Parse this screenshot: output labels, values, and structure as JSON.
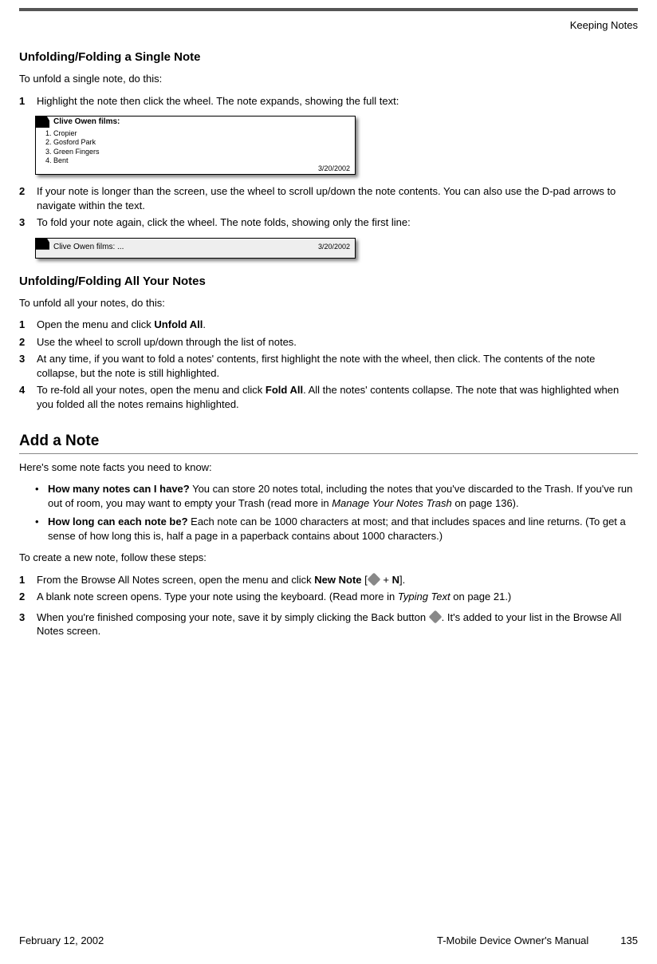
{
  "running_header": "Keeping Notes",
  "section1": {
    "heading": "Unfolding/Folding a Single Note",
    "intro": "To unfold a single note, do this:",
    "steps": [
      {
        "n": "1",
        "text": "Highlight the note then click the wheel. The note expands, showing the full text:"
      },
      {
        "n": "2",
        "text": "If your note is longer than the screen, use the wheel to scroll up/down the note contents. You can also use the D-pad arrows to navigate within the text."
      },
      {
        "n": "3",
        "text": "To fold your note again, click the wheel. The note folds, showing only the first line:"
      }
    ],
    "expanded_note": {
      "title": "Clive Owen films:",
      "lines": "1. Cropier\n2. Gosford Park\n3. Green Fingers\n4. Bent",
      "date": "3/20/2002"
    },
    "collapsed_note": {
      "title": "Clive Owen films: ...",
      "date": "3/20/2002"
    }
  },
  "section2": {
    "heading": "Unfolding/Folding All Your Notes",
    "intro": "To unfold all your notes, do this:",
    "steps": [
      {
        "n": "1",
        "pre": "Open the menu and click ",
        "bold": "Unfold All",
        "post": "."
      },
      {
        "n": "2",
        "text": "Use the wheel to scroll up/down through the list of notes."
      },
      {
        "n": "3",
        "text": "At any time, if you want to fold a notes' contents, first highlight the note with the wheel, then click. The contents of the note collapse, but the note is still highlighted."
      },
      {
        "n": "4",
        "pre": "To re-fold all your notes, open the menu and click ",
        "bold": "Fold All",
        "post": ". All the notes' contents collapse. The note that was highlighted when you folded all the notes remains highlighted."
      }
    ]
  },
  "section3": {
    "heading": "Add a Note",
    "intro": "Here's some note facts you need to know:",
    "bullets": [
      {
        "bold": "How many notes can I have?",
        "rest_a": " You can store 20 notes total, including the notes that you've discarded to the Trash. If you've run out of room, you may want to empty your Trash (read more in ",
        "ital": "Manage Your Notes Trash",
        "rest_b": " on page 136)."
      },
      {
        "bold": "How long can each note be?",
        "rest_a": " Each note can be 1000 characters at most; and that includes spaces and line returns. (To get a sense of how long this is, half a page in a paperback contains about 1000 characters.)",
        "ital": "",
        "rest_b": ""
      }
    ],
    "intro2": "To create a new note, follow these steps:",
    "steps": [
      {
        "n": "1",
        "pre": "From the Browse All Notes screen, open the menu and click ",
        "bold": "New Note",
        "mid": " [",
        "plus": " + ",
        "key": "N",
        "post": "]."
      },
      {
        "n": "2",
        "pre": "A blank note screen opens. Type your note using the keyboard. (Read more in ",
        "ital": "Typing Text",
        "post": " on page 21.)"
      },
      {
        "n": "3",
        "pre": "When you're finished composing your note, save it by simply clicking the Back button ",
        "post": ". It's added to your list in the Browse All Notes screen."
      }
    ]
  },
  "footer": {
    "date": "February 12, 2002",
    "manual": "T-Mobile Device Owner's Manual",
    "page": "135"
  }
}
